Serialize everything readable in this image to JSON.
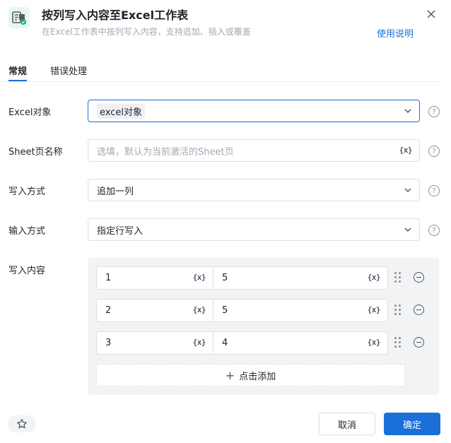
{
  "header": {
    "title": "按列写入内容至Excel工作表",
    "subtitle": "在Excel工作表中按列写入内容，支持追加、插入或覆盖",
    "help_link": "使用说明",
    "icon": "excel-write-icon",
    "close_icon": "close-icon"
  },
  "tabs": [
    {
      "label": "常规",
      "active": true
    },
    {
      "label": "错误处理",
      "active": false
    }
  ],
  "fields": {
    "excel_object": {
      "label": "Excel对象",
      "value": "excel对象"
    },
    "sheet_name": {
      "label": "Sheet页名称",
      "placeholder": "选填，默认为当前激活的Sheet页"
    },
    "write_mode": {
      "label": "写入方式",
      "value": "追加一列"
    },
    "input_mode": {
      "label": "输入方式",
      "value": "指定行写入"
    },
    "write_content": {
      "label": "写入内容"
    }
  },
  "var_icon_text": "{x}",
  "help_glyph": "?",
  "content_rows": [
    {
      "left": "1",
      "right": "5"
    },
    {
      "left": "2",
      "right": "5"
    },
    {
      "left": "3",
      "right": "4"
    }
  ],
  "add_button": {
    "plus": "+",
    "label": "点击添加"
  },
  "footer": {
    "cancel": "取消",
    "confirm": "确定",
    "star_icon": "star-icon"
  },
  "colors": {
    "accent": "#1a6fd8",
    "icon_bg": "#e9f7ee",
    "excel_green": "#21a366"
  }
}
